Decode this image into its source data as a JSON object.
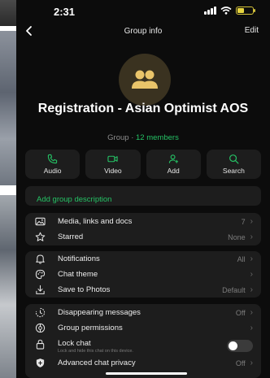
{
  "status_bar": {
    "time": "2:31"
  },
  "nav": {
    "back_label": "<",
    "title": "Group info",
    "edit_label": "Edit"
  },
  "group": {
    "name": "Registration - Asian Optimist AOS",
    "meta_prefix": "Group · ",
    "members": "12 members"
  },
  "actions": [
    {
      "label": "Audio",
      "icon": "phone-icon"
    },
    {
      "label": "Video",
      "icon": "video-icon"
    },
    {
      "label": "Add",
      "icon": "add-user-icon"
    },
    {
      "label": "Search",
      "icon": "search-icon"
    }
  ],
  "description": {
    "placeholder": "Add group description"
  },
  "section1": [
    {
      "label": "Media, links and docs",
      "value": "7",
      "icon": "image-icon"
    },
    {
      "label": "Starred",
      "value": "None",
      "icon": "star-icon"
    }
  ],
  "section2": [
    {
      "label": "Notifications",
      "value": "All",
      "icon": "bell-icon"
    },
    {
      "label": "Chat theme",
      "value": "",
      "icon": "palette-icon"
    },
    {
      "label": "Save to Photos",
      "value": "Default",
      "icon": "save-icon"
    }
  ],
  "section3": [
    {
      "label": "Disappearing messages",
      "value": "Off",
      "icon": "timer-icon"
    },
    {
      "label": "Group permissions",
      "value": "",
      "icon": "settings-icon"
    },
    {
      "label": "Lock chat",
      "sub": "Lock and hide this chat on this device.",
      "icon": "lock-icon",
      "toggle": false
    },
    {
      "label": "Advanced chat privacy",
      "value": "Off",
      "icon": "shield-icon"
    }
  ],
  "colors": {
    "accent": "#25c265",
    "background": "#0c0c0c",
    "card": "#1d1d1d",
    "avatar": "#3a3220",
    "avatar_icon": "#e9c46a",
    "battery": "#e7d540"
  }
}
